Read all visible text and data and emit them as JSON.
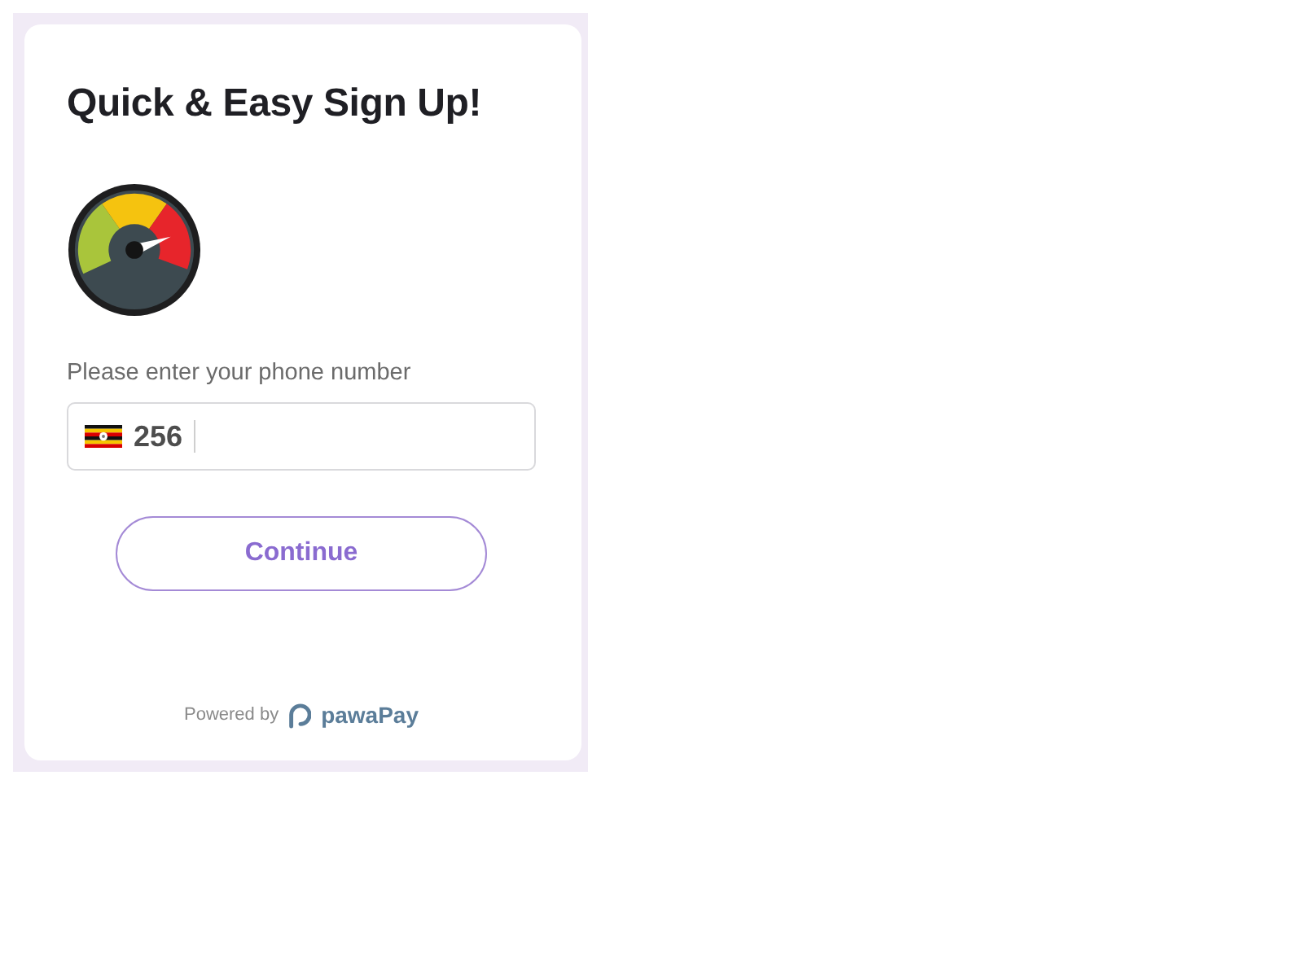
{
  "title": "Quick & Easy Sign Up!",
  "phone": {
    "label": "Please enter your phone number",
    "country_code": "256"
  },
  "continue_button": {
    "label": "Continue"
  },
  "footer": {
    "powered_by": "Powered by",
    "brand": "pawaPay"
  }
}
